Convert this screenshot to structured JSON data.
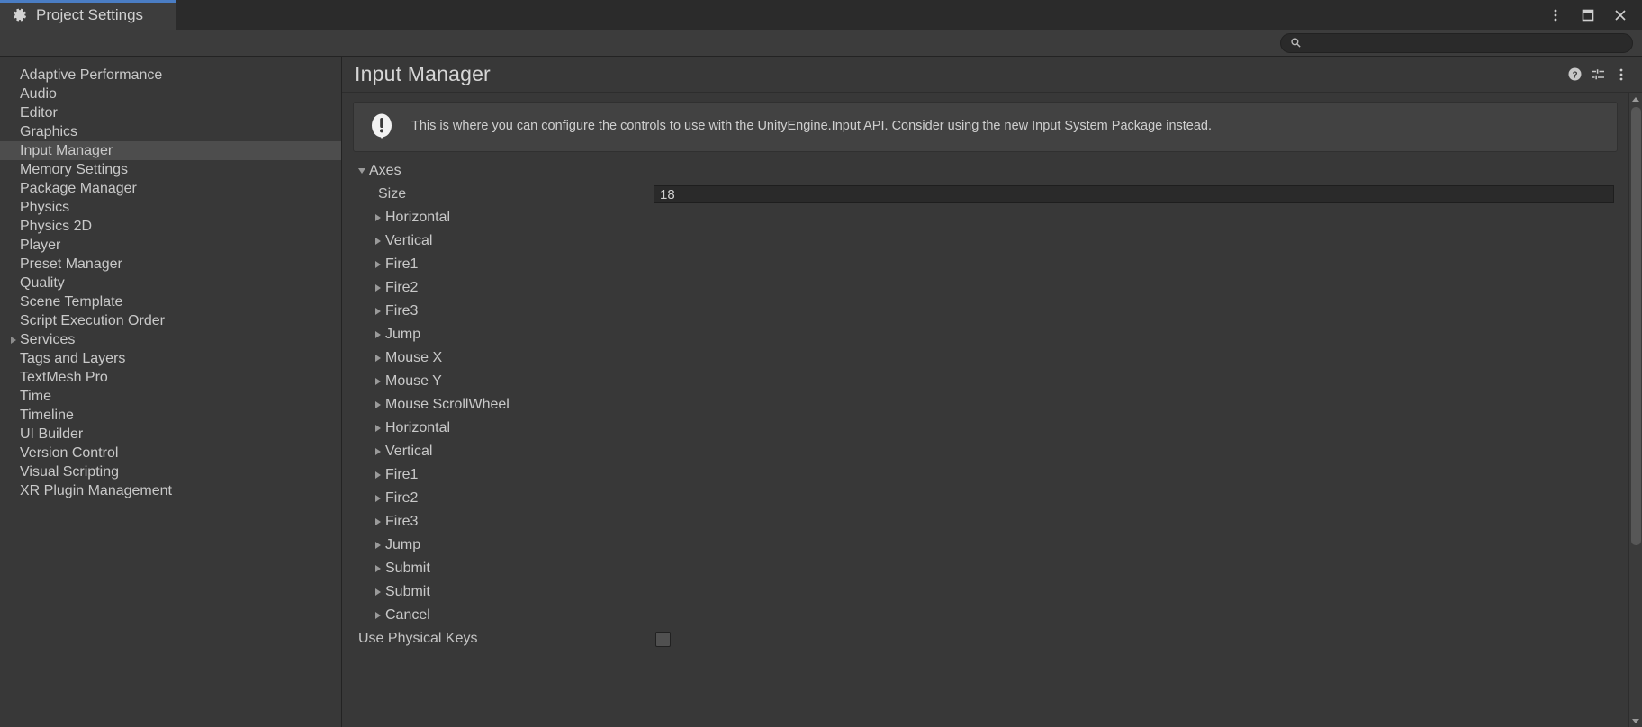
{
  "window": {
    "tab_label": "Project Settings",
    "tab_icon": "gear-icon",
    "controls": [
      {
        "name": "window-menu-button",
        "icon": "kebab-menu-icon"
      },
      {
        "name": "window-maximize-button",
        "icon": "maximize-icon"
      },
      {
        "name": "window-close-button",
        "icon": "close-icon"
      }
    ],
    "accent_color": "#4a7dc4"
  },
  "search": {
    "value": "",
    "placeholder": "",
    "icon": "search-icon"
  },
  "sidebar": {
    "items": [
      {
        "label": "Adaptive Performance",
        "expandable": false,
        "selected": false
      },
      {
        "label": "Audio",
        "expandable": false,
        "selected": false
      },
      {
        "label": "Editor",
        "expandable": false,
        "selected": false
      },
      {
        "label": "Graphics",
        "expandable": false,
        "selected": false
      },
      {
        "label": "Input Manager",
        "expandable": false,
        "selected": true
      },
      {
        "label": "Memory Settings",
        "expandable": false,
        "selected": false
      },
      {
        "label": "Package Manager",
        "expandable": false,
        "selected": false
      },
      {
        "label": "Physics",
        "expandable": false,
        "selected": false
      },
      {
        "label": "Physics 2D",
        "expandable": false,
        "selected": false
      },
      {
        "label": "Player",
        "expandable": false,
        "selected": false
      },
      {
        "label": "Preset Manager",
        "expandable": false,
        "selected": false
      },
      {
        "label": "Quality",
        "expandable": false,
        "selected": false
      },
      {
        "label": "Scene Template",
        "expandable": false,
        "selected": false
      },
      {
        "label": "Script Execution Order",
        "expandable": false,
        "selected": false
      },
      {
        "label": "Services",
        "expandable": true,
        "selected": false
      },
      {
        "label": "Tags and Layers",
        "expandable": false,
        "selected": false
      },
      {
        "label": "TextMesh Pro",
        "expandable": false,
        "selected": false
      },
      {
        "label": "Time",
        "expandable": false,
        "selected": false
      },
      {
        "label": "Timeline",
        "expandable": false,
        "selected": false
      },
      {
        "label": "UI Builder",
        "expandable": false,
        "selected": false
      },
      {
        "label": "Version Control",
        "expandable": false,
        "selected": false
      },
      {
        "label": "Visual Scripting",
        "expandable": false,
        "selected": false
      },
      {
        "label": "XR Plugin Management",
        "expandable": false,
        "selected": false
      }
    ]
  },
  "main": {
    "title": "Input Manager",
    "header_icons": [
      {
        "name": "help-icon",
        "label": "?"
      },
      {
        "name": "preset-settings-icon",
        "label": ""
      },
      {
        "name": "kebab-menu-icon",
        "label": ""
      }
    ],
    "banner": {
      "icon": "warning-icon",
      "message": "This is where you can configure the controls to use with the UnityEngine.Input API. Consider using the new Input System Package instead."
    },
    "axes_section": {
      "label": "Axes",
      "expanded": true,
      "size_label": "Size",
      "size_value": "18",
      "axes": [
        {
          "label": "Horizontal",
          "expanded": false
        },
        {
          "label": "Vertical",
          "expanded": false
        },
        {
          "label": "Fire1",
          "expanded": false
        },
        {
          "label": "Fire2",
          "expanded": false
        },
        {
          "label": "Fire3",
          "expanded": false
        },
        {
          "label": "Jump",
          "expanded": false
        },
        {
          "label": "Mouse X",
          "expanded": false
        },
        {
          "label": "Mouse Y",
          "expanded": false
        },
        {
          "label": "Mouse ScrollWheel",
          "expanded": false
        },
        {
          "label": "Horizontal",
          "expanded": false
        },
        {
          "label": "Vertical",
          "expanded": false
        },
        {
          "label": "Fire1",
          "expanded": false
        },
        {
          "label": "Fire2",
          "expanded": false
        },
        {
          "label": "Fire3",
          "expanded": false
        },
        {
          "label": "Jump",
          "expanded": false
        },
        {
          "label": "Submit",
          "expanded": false
        },
        {
          "label": "Submit",
          "expanded": false
        },
        {
          "label": "Cancel",
          "expanded": false
        }
      ]
    },
    "use_physical_keys": {
      "label": "Use Physical Keys",
      "checked": false
    }
  },
  "scrollbar": {
    "up_arrow": "chevron-up-icon",
    "down_arrow": "chevron-down-icon"
  }
}
